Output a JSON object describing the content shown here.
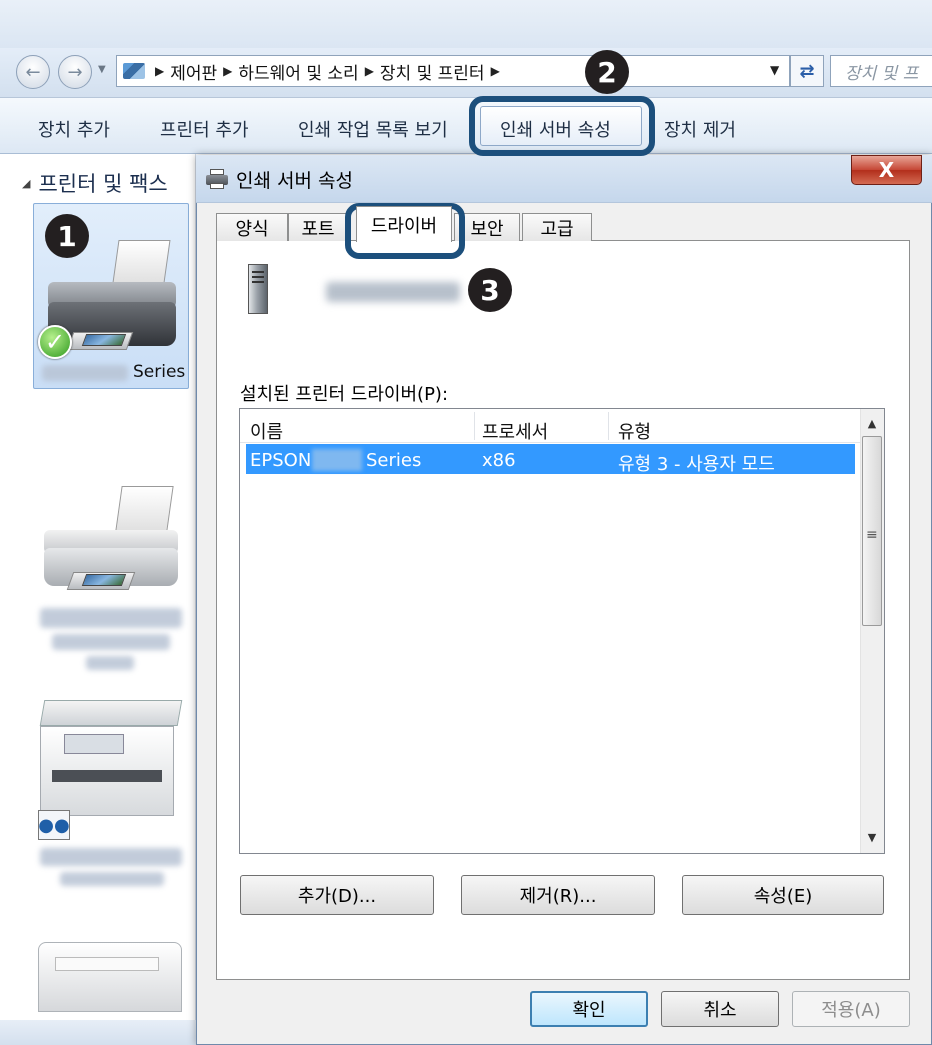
{
  "explorer": {
    "breadcrumbs": [
      "제어판",
      "하드웨어 및 소리",
      "장치 및 프린터"
    ],
    "search_placeholder": "장치 및 프",
    "toolbar": {
      "add_device": "장치 추가",
      "add_printer": "프린터 추가",
      "view_queue": "인쇄 작업 목록 보기",
      "server_props": "인쇄 서버 속성",
      "remove_device": "장치 제거"
    },
    "section_title": "프린터 및 팩스",
    "selected_printer_suffix": "Series"
  },
  "dialog": {
    "title": "인쇄 서버 속성",
    "close_glyph": "X",
    "tabs": [
      "양식",
      "포트",
      "드라이버",
      "보안",
      "고급"
    ],
    "active_tab": "드라이버",
    "drivers_label": "설치된 프린터 드라이버(P):",
    "columns": [
      "이름",
      "프로세서",
      "유형"
    ],
    "rows": [
      {
        "name_prefix": "EPSON",
        "name_suffix": "Series",
        "processor": "x86",
        "type": "유형 3 - 사용자 모드"
      }
    ],
    "buttons": {
      "add": "추가(D)...",
      "remove": "제거(R)...",
      "properties": "속성(E)",
      "ok": "확인",
      "cancel": "취소",
      "apply": "적용(A)"
    }
  },
  "annotations": {
    "step1": "1",
    "step2": "2",
    "step3": "3"
  },
  "colors": {
    "callout": "#1c4f7c",
    "selection": "#3399ff",
    "badge": "#231f20"
  }
}
